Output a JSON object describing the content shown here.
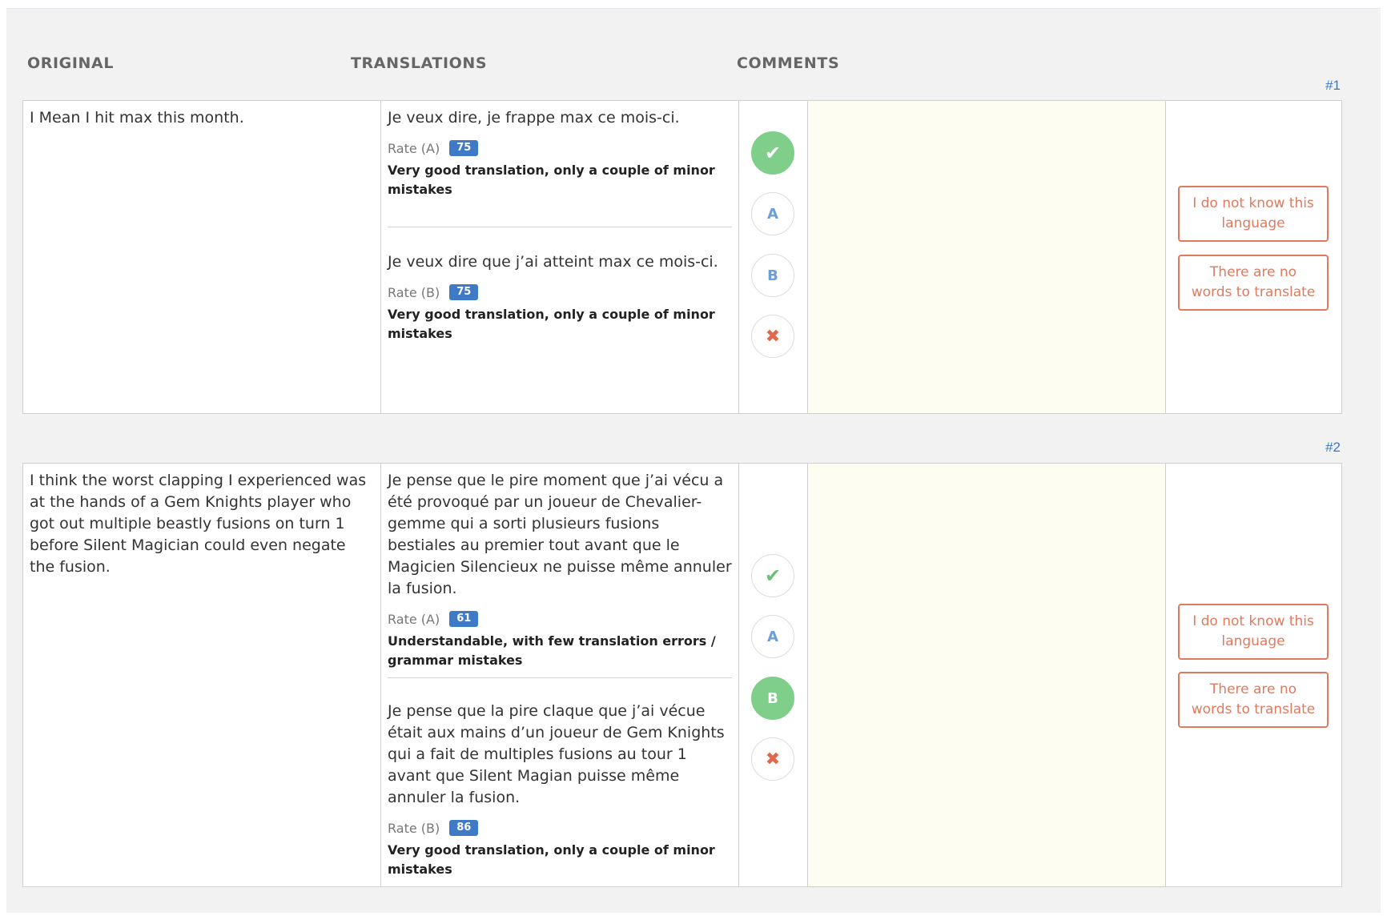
{
  "headers": {
    "original": "ORIGINAL",
    "translations": "TRANSLATIONS",
    "comments": "COMMENTS"
  },
  "items": [
    {
      "number": "#1",
      "original": "I Mean I hit max this month.",
      "translation_a": {
        "text": "Je veux dire, je frappe max ce mois-ci.",
        "rate_label": "Rate (A)",
        "score": "75",
        "description": "Very good translation, only a couple of minor mistakes"
      },
      "translation_b": {
        "text": "Je veux dire que j’ai atteint max ce mois-ci.",
        "rate_label": "Rate (B)",
        "score": "75",
        "description": "Very good translation, only a couple of minor mistakes"
      },
      "choices": {
        "accept": "✔",
        "a": "A",
        "b": "B",
        "reject": "✖",
        "selected": "accept"
      },
      "comment": "",
      "actions": {
        "unknown_language": "I do not know this language",
        "no_words": "There are no words to translate"
      }
    },
    {
      "number": "#2",
      "original": "I think the worst clapping I experienced was at the hands of a Gem Knights player who got out multiple beastly fusions on turn 1 before Silent Magician could even negate the fusion.",
      "translation_a": {
        "text": "Je pense que le pire moment que j’ai vécu a été provoqué par un joueur de Chevalier-gemme qui a sorti plusieurs fusions bestiales au premier tout avant que le Magicien Silencieux ne puisse même annuler la fusion.",
        "rate_label": "Rate (A)",
        "score": "61",
        "description": "Understandable, with few translation errors / grammar mistakes"
      },
      "translation_b": {
        "text": "Je pense que la pire claque que j’ai vécue était aux mains d’un joueur de Gem Knights qui a fait de multiples fusions au tour 1 avant que Silent Magian puisse même annuler la fusion.",
        "rate_label": "Rate (B)",
        "score": "86",
        "description": "Very good translation, only a couple of minor mistakes"
      },
      "choices": {
        "accept": "✔",
        "a": "A",
        "b": "B",
        "reject": "✖",
        "selected": "b"
      },
      "comment": "",
      "actions": {
        "unknown_language": "I do not know this language",
        "no_words": "There are no words to translate"
      }
    }
  ],
  "colors": {
    "accent_blue": "#3f7ac7",
    "selected_green": "#7fcf8a",
    "reject_red": "#e06a4b",
    "action_orange": "#e07a5f",
    "comment_bg": "#fdfdf2"
  }
}
